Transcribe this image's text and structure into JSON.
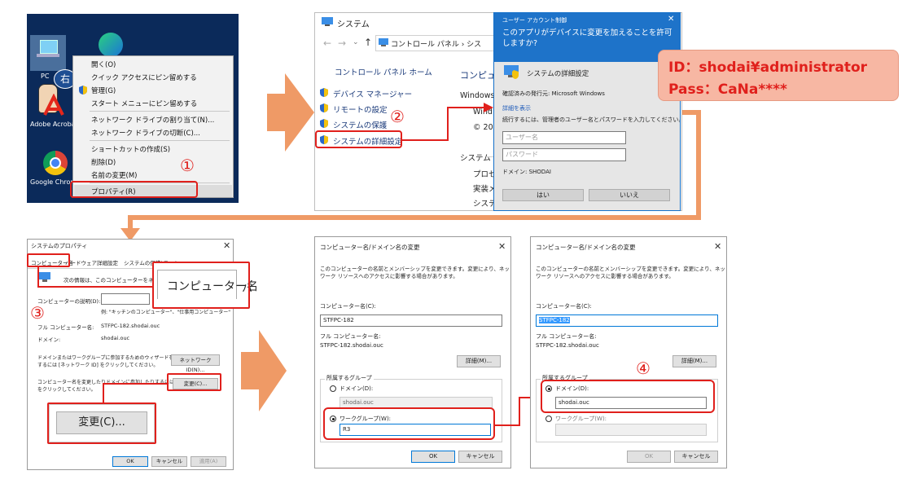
{
  "panel1": {
    "desktop_icons": {
      "pc": "PC",
      "adobe": "Adobe Acrobat",
      "chrome": "Google Chrome",
      "migi": "右"
    },
    "menu": [
      "開く(O)",
      "クイック アクセスにピン留めする",
      "管理(G)",
      "スタート メニューにピン留めする",
      "ネットワーク ドライブの割り当て(N)...",
      "ネットワーク ドライブの切断(C)...",
      "ショートカットの作成(S)",
      "削除(D)",
      "名前の変更(M)",
      "プロパティ(R)"
    ],
    "step": "①"
  },
  "panel2": {
    "title": "システム",
    "address": "コントロール パネル › シス",
    "home": "コントロール パネル ホーム",
    "links": [
      "デバイス マネージャー",
      "リモートの設定",
      "システムの保護",
      "システムの詳細設定"
    ],
    "right_texts": [
      "コンピュー",
      "Windows",
      "Wind",
      "© 201",
      "システム",
      "プロセ",
      "実装メ",
      "システ"
    ],
    "step": "②"
  },
  "uac": {
    "header": "ユーザー アカウント制御",
    "question": "このアプリがデバイスに変更を加えることを許可しますか?",
    "app": "システムの詳細設定",
    "publisher": "確認済みの発行元: Microsoft Windows",
    "details": "詳細を表示",
    "instruction": "続行するには、管理者のユーザー名とパスワードを入力してください。",
    "user_placeholder": "ユーザー名",
    "pass_placeholder": "パスワード",
    "domain": "ドメイン: SHODAI",
    "yes": "はい",
    "no": "いいえ"
  },
  "callout": {
    "id": "ID：shodai¥administrator",
    "pass": "Pass：CaNa****"
  },
  "panel3": {
    "title": "システムのプロパティ",
    "tabs": [
      "コンピューター名",
      "ハードウェア",
      "詳細設定",
      "システムの保護",
      "リモート"
    ],
    "zoom_tab": "コンピューター名",
    "zoom_tab_next": "ハ",
    "info": "次の情報は、このコンピューターをネットワーク",
    "desc_label": "コンピューターの説明(D):",
    "example": "例: \"キッチンのコンピューター\"、\"仕事用コンピューター\"",
    "full_label": "フル コンピューター名:",
    "full_value": "STFPC-182.shodai.ouc",
    "domain_label": "ドメイン:",
    "domain_value": "shodai.ouc",
    "wizard_text_1": "ドメインまたはワークグループに参加するためのウィザードを使用",
    "wizard_text_2": "するには [ネットワーク ID] をクリックしてください。",
    "netid_button": "ネットワーク ID(N)...",
    "rename_text_1": "コンピューター名を変更したりドメインに参加したりするには [変更]",
    "rename_text_2": "をクリックしてください。",
    "change_button": "変更(C)...",
    "change_zoom": "変更(C)...",
    "ok": "OK",
    "cancel": "キャンセル",
    "apply": "適用(A)",
    "step": "③"
  },
  "panel4": {
    "title": "コンピューター名/ドメイン名の変更",
    "desc_1": "このコンピューターの名前とメンバーシップを変更できます。変更により、ネット",
    "desc_2": "ワーク リソースへのアクセスに影響する場合があります。",
    "name_label": "コンピューター名(C):",
    "name_value": "STFPC-182",
    "full_label": "フル コンピューター名:",
    "full_value": "STFPC-182.shodai.ouc",
    "details": "詳細(M)...",
    "group": "所属するグループ",
    "domain_radio": "ドメイン(D):",
    "domain_value": "shodai.ouc",
    "workgroup_radio": "ワークグループ(W):",
    "workgroup_value": "R3",
    "ok": "OK",
    "cancel": "キャンセル"
  },
  "panel5": {
    "title": "コンピューター名/ドメイン名の変更",
    "desc_1": "このコンピューターの名前とメンバーシップを変更できます。変更により、ネット",
    "desc_2": "ワーク リソースへのアクセスに影響する場合があります。",
    "name_label": "コンピューター名(C):",
    "name_value": "STFPC-182",
    "full_label": "フル コンピューター名:",
    "full_value": "STFPC-182.shodai.ouc",
    "details": "詳細(M)...",
    "group": "所属するグループ",
    "domain_radio": "ドメイン(D):",
    "domain_value": "shodai.ouc",
    "workgroup_radio": "ワークグループ(W):",
    "ok": "OK",
    "cancel": "キャンセル",
    "step": "④"
  },
  "colors": {
    "accent": "#e0201c",
    "arrow": "#ef9a66",
    "callout_bg": "#f7b7a3",
    "desktop": "#0b2a5a",
    "selection": "#3399ff"
  }
}
